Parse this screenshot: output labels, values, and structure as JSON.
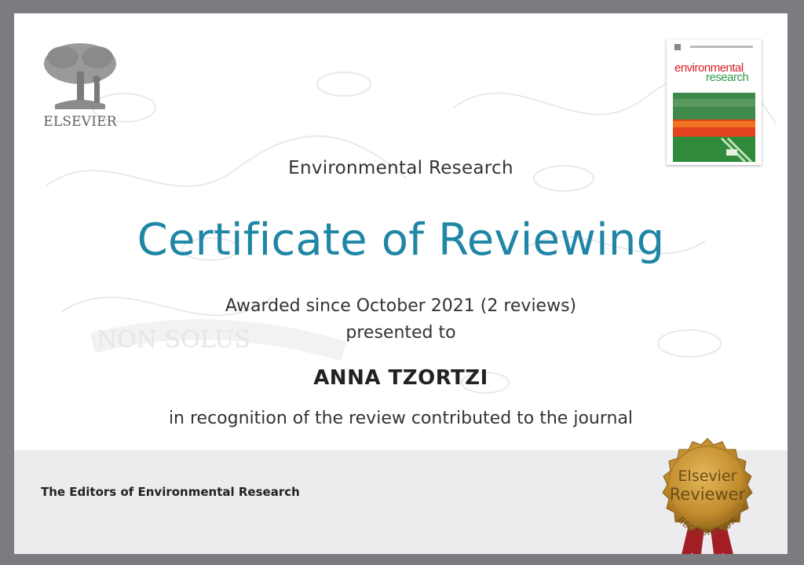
{
  "publisher": {
    "logo_word": "ELSEVIER"
  },
  "cover": {
    "title_line1": "environmental",
    "title_line2": "research"
  },
  "certificate": {
    "journal": "Environmental Research",
    "title": "Certificate of Reviewing",
    "awarded": "Awarded since October 2021 (2 reviews)",
    "presented": "presented to",
    "recipient": "ANNA TZORTZI",
    "recognition": "in recognition of the review contributed to the journal",
    "editors": "The Editors of Environmental Research"
  },
  "seal": {
    "line1": "Elsevier",
    "line2": "Reviewer",
    "arc": "RECOGNITION"
  },
  "colors": {
    "frame": "#7b7b80",
    "title_blue": "#1f86a6",
    "seal_gold": "#c99a3a",
    "ribbon_red": "#a31d24"
  }
}
